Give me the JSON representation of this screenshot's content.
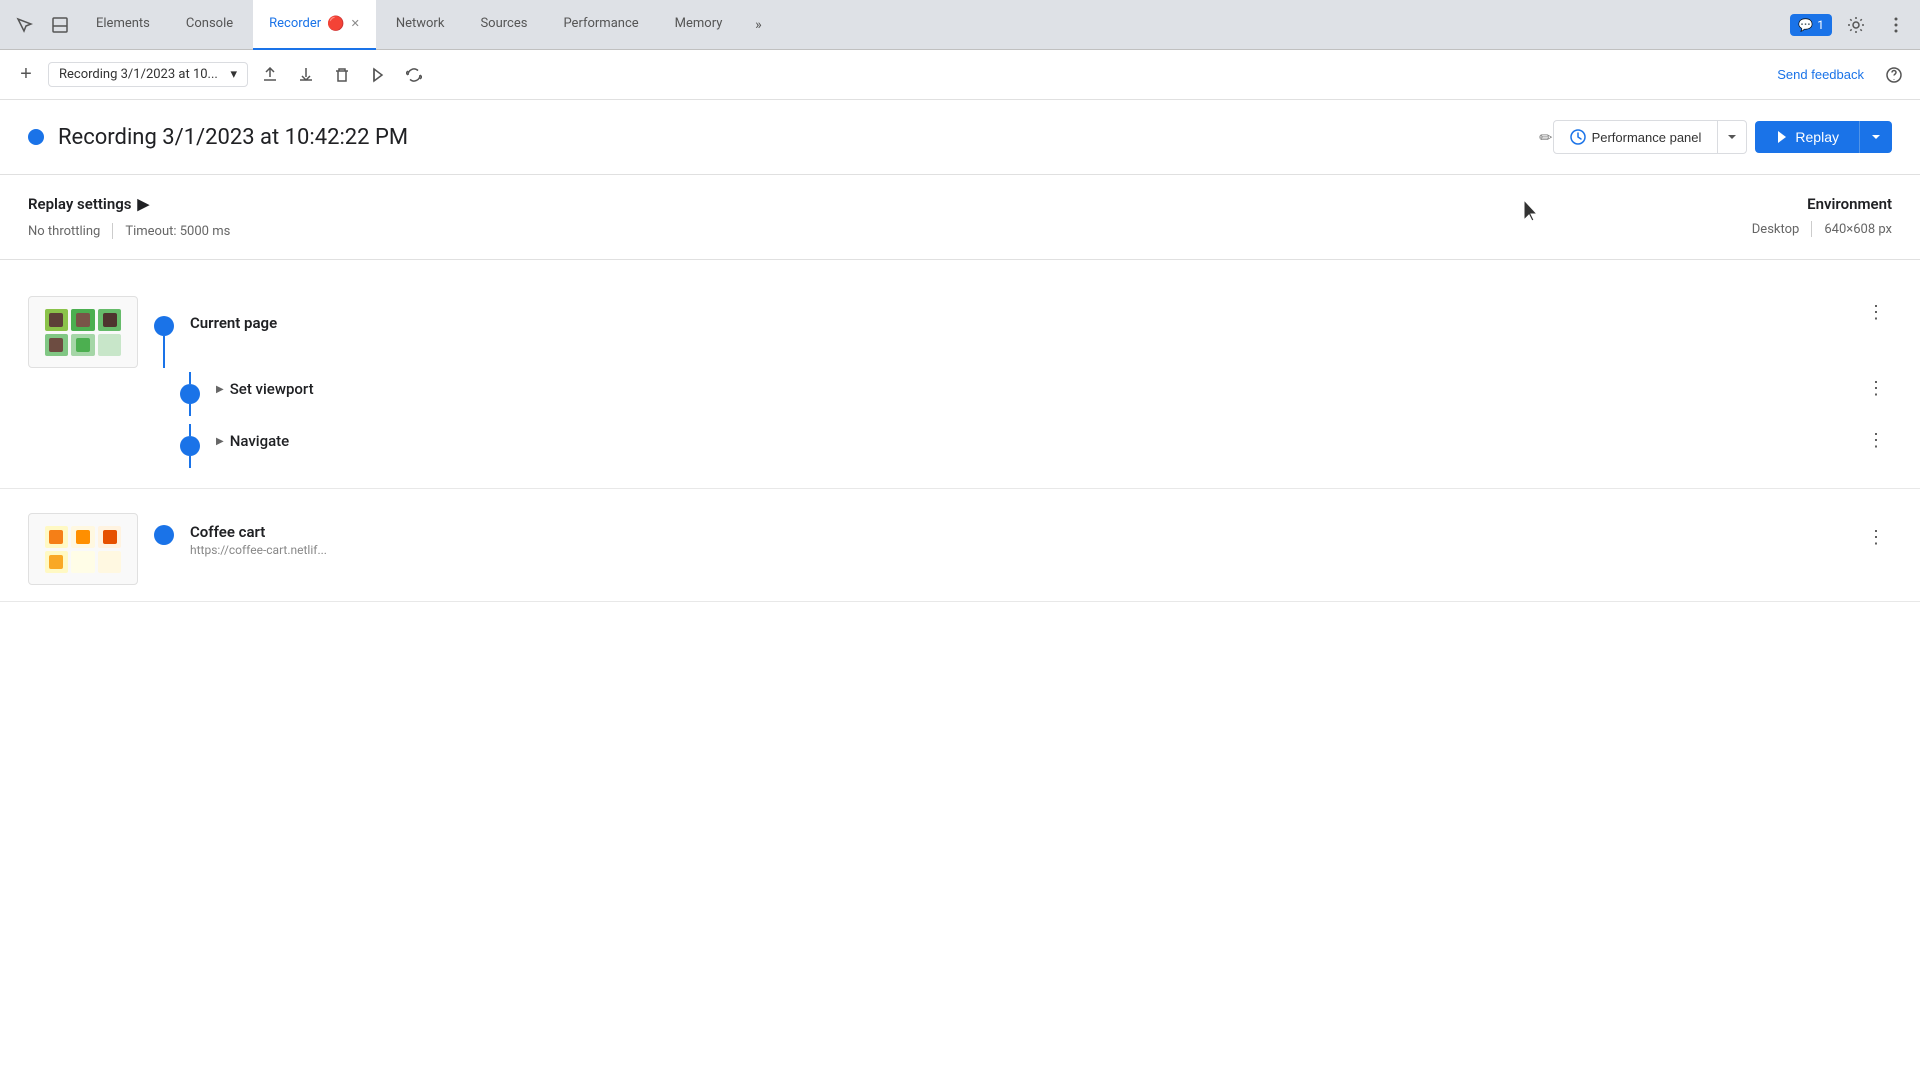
{
  "tabs": {
    "items": [
      {
        "label": "Elements",
        "active": false
      },
      {
        "label": "Console",
        "active": false
      },
      {
        "label": "Recorder",
        "active": true
      },
      {
        "label": "Network",
        "active": false
      },
      {
        "label": "Sources",
        "active": false
      },
      {
        "label": "Performance",
        "active": false
      },
      {
        "label": "Memory",
        "active": false
      }
    ],
    "more_label": "»"
  },
  "chat_badge": {
    "count": "1",
    "icon": "💬"
  },
  "toolbar": {
    "add_icon": "+",
    "recording_name": "Recording 3/1/2023 at 10...",
    "dropdown_icon": "▾",
    "send_feedback_label": "Send feedback",
    "help_icon": "?",
    "upload_icon": "⬆",
    "download_icon": "⬇",
    "delete_icon": "🗑",
    "replay_icon": "⏵",
    "loop_icon": "↺"
  },
  "recording": {
    "title": "Recording 3/1/2023 at 10:42:22 PM",
    "edit_icon": "✏",
    "dot_color": "#1a73e8",
    "performance_panel_label": "Performance panel",
    "replay_label": "Replay"
  },
  "settings": {
    "title": "Replay settings",
    "chevron": "▶",
    "throttling": "No throttling",
    "timeout": "Timeout: 5000 ms",
    "environment_label": "Environment",
    "device": "Desktop",
    "resolution": "640×608 px"
  },
  "steps": [
    {
      "id": "current-page",
      "title": "Current page",
      "subtitle": "",
      "has_screenshot": true,
      "screenshot_type": "coffee-shop",
      "sub_steps": [
        {
          "title": "Set viewport",
          "expandable": true
        },
        {
          "title": "Navigate",
          "expandable": true
        }
      ]
    },
    {
      "id": "coffee-cart",
      "title": "Coffee cart",
      "subtitle": "https://coffee-cart.netlif...",
      "has_screenshot": true,
      "screenshot_type": "coffee-cart"
    }
  ],
  "colors": {
    "blue": "#1a73e8",
    "timeline": "#1a73e8",
    "tab_active_border": "#1a73e8"
  }
}
